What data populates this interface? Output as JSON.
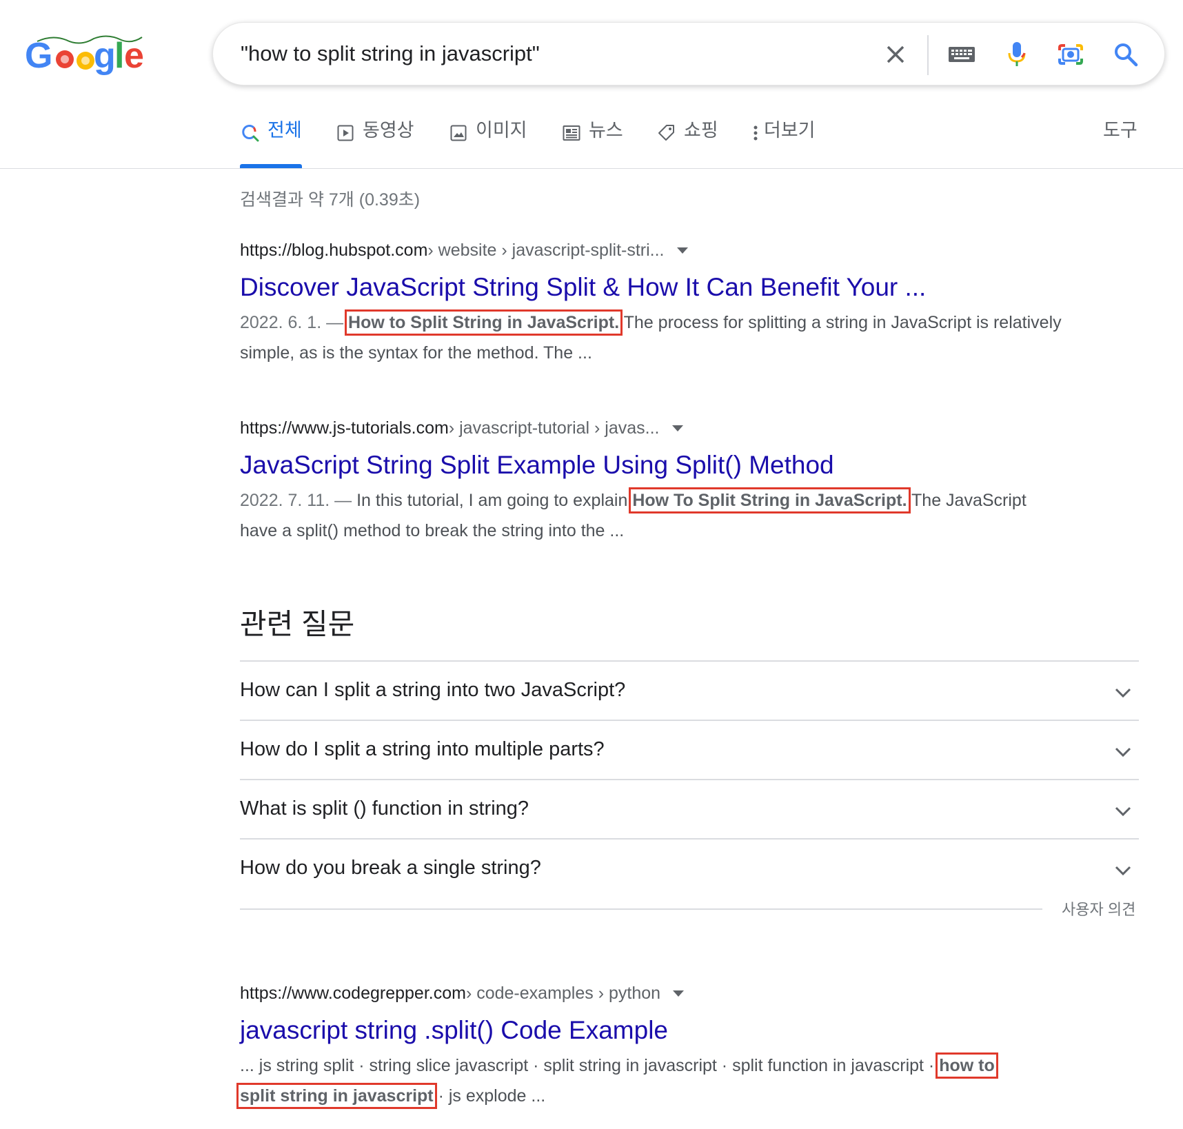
{
  "search": {
    "query": "\"how to split string in javascript\""
  },
  "header": {
    "logo_alt": "Google",
    "icons": [
      "google-logo",
      "close-icon",
      "keyboard-icon",
      "mic-icon",
      "camera-icon",
      "search-icon"
    ]
  },
  "tabs": {
    "all": "전체",
    "videos": "동영상",
    "images": "이미지",
    "news": "뉴스",
    "shopping": "쇼핑",
    "more": "더보기",
    "tools": "도구"
  },
  "result_stats": "검색결과 약 7개 (0.39초)",
  "results": [
    {
      "host": "https://blog.hubspot.com",
      "crumbs": " › website › javascript-split-stri...",
      "title": "Discover JavaScript String Split & How It Can Benefit Your ...",
      "date": "2022. 6. 1. — ",
      "highlight": "How to Split String in JavaScript.",
      "snippet_after": " The process for splitting a string in JavaScript is relatively simple, as is the syntax for the method. The ..."
    },
    {
      "host": "https://www.js-tutorials.com",
      "crumbs": " › javascript-tutorial › javas...",
      "title": "JavaScript String Split Example Using Split() Method",
      "date": "2022. 7. 11. — ",
      "snippet_before": "In this tutorial, I am going to explain ",
      "highlight": "How To Split String in JavaScript.",
      "snippet_after": " The JavaScript have a split() method to break the string into the ..."
    },
    {
      "host": "https://www.codegrepper.com",
      "crumbs": " › code-examples › python",
      "title": "javascript string .split() Code Example",
      "snippet_before": "... js string split · string slice javascript · split string in javascript · split function in javascript · ",
      "highlight_a": "how to",
      "highlight_b": "split string in javascript",
      "snippet_after": " · js explode ..."
    }
  ],
  "related_questions": {
    "title": "관련 질문",
    "items": [
      "How can I split a string into two JavaScript?",
      "How do I split a string into multiple parts?",
      "What is split () function in string?",
      "How do you break a single string?"
    ],
    "feedback": "사용자 의견"
  },
  "colors": {
    "link": "#1a0dab",
    "accent": "#1a73e8",
    "highlight_box": "#e0392b",
    "text": "#202124",
    "muted": "#70757a"
  }
}
